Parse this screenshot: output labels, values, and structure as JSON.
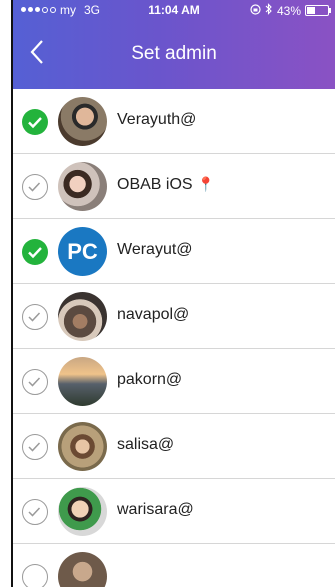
{
  "status_bar": {
    "carrier": "my",
    "network": "3G",
    "time": "11:04 AM",
    "battery": "43%",
    "battery_level": 0.43
  },
  "nav": {
    "title": "Set admin",
    "back_icon": "chevron-left-icon"
  },
  "users": [
    {
      "name": "Verayuth@",
      "selected": true,
      "avatar": "photo"
    },
    {
      "name": "OBAB iOS",
      "selected": false,
      "avatar": "photo",
      "badge": "📍"
    },
    {
      "name": "Werayut@",
      "selected": true,
      "avatar": "PC"
    },
    {
      "name": "navapol@",
      "selected": false,
      "avatar": "photo"
    },
    {
      "name": "pakorn@",
      "selected": false,
      "avatar": "photo"
    },
    {
      "name": "salisa@",
      "selected": false,
      "avatar": "photo"
    },
    {
      "name": "warisara@",
      "selected": false,
      "avatar": "photo"
    }
  ],
  "colors": {
    "header_start": "#5560d4",
    "header_end": "#8a52c4",
    "check_on": "#23b33c",
    "pc_avatar": "#1a78c2"
  }
}
